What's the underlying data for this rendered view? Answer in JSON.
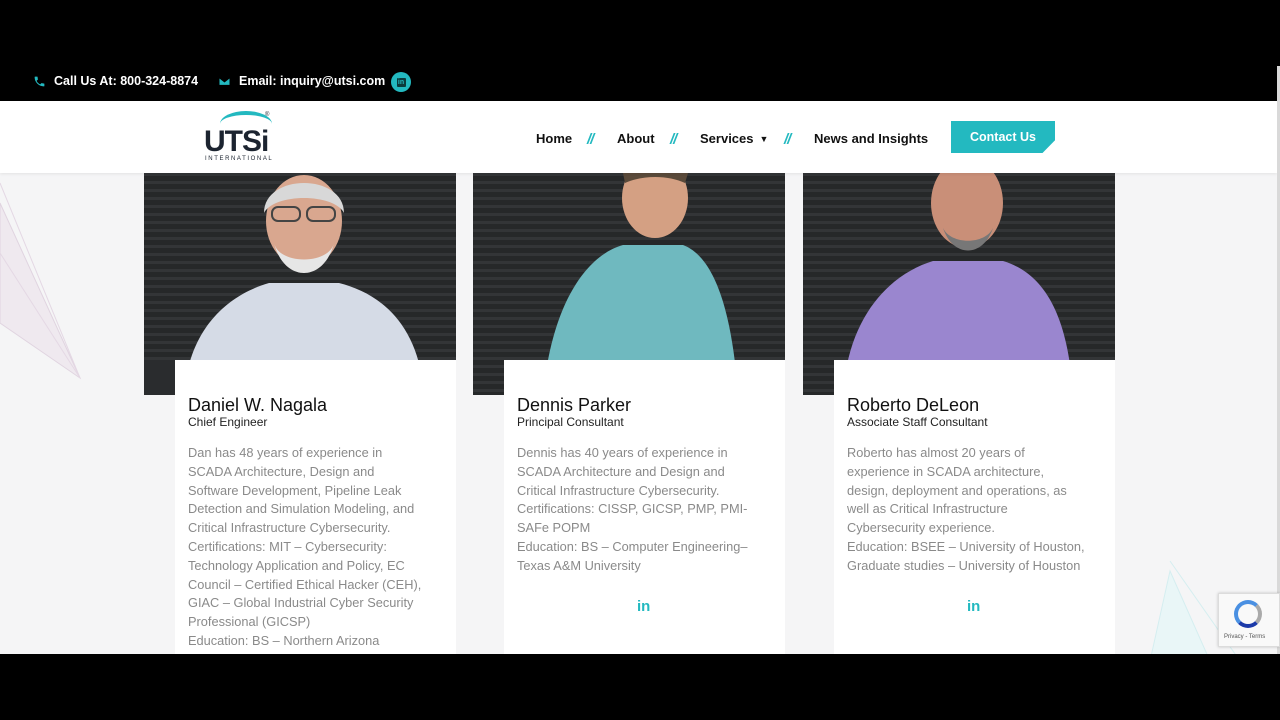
{
  "topbar": {
    "phone": "Call Us At: 800-324-8874",
    "email": "Email: inquiry@utsi.com",
    "linkedin": "in"
  },
  "logo": {
    "name": "UTSi",
    "subtitle": "INTERNATIONAL",
    "reg": "®"
  },
  "nav": {
    "home": "Home",
    "about": "About",
    "services": "Services",
    "news": "News and Insights",
    "separator": "//",
    "contact": "Contact Us"
  },
  "team": [
    {
      "name": "Daniel W. Nagala",
      "role": "Chief Engineer",
      "bio": "Dan has 48 years of experience in\nSCADA Architecture, Design and\nSoftware Development, Pipeline Leak\nDetection and Simulation Modeling, and\nCritical Infrastructure Cybersecurity.\nCertifications: MIT – Cybersecurity:\nTechnology Application and Policy, EC\nCouncil – Certified Ethical Hacker (CEH),\nGIAC – Global Industrial Cyber Security\nProfessional (GICSP)\nEducation: BS – Northern Arizona",
      "linkedin": ""
    },
    {
      "name": "Dennis Parker",
      "role": "Principal Consultant",
      "bio": "Dennis has 40 years of experience in\nSCADA Architecture and Design and\nCritical Infrastructure Cybersecurity.\nCertifications: CISSP, GICSP, PMP, PMI-\nSAFe POPM\nEducation: BS – Computer Engineering–\nTexas A&M University",
      "linkedin": "in"
    },
    {
      "name": "Roberto DeLeon",
      "role": "Associate Staff Consultant",
      "bio": "Roberto has almost 20 years of\nexperience in SCADA architecture,\ndesign, deployment and operations, as\nwell as Critical Infrastructure\nCybersecurity experience.\nEducation: BSEE – University of Houston,\nGraduate studies – University of Houston",
      "linkedin": "in"
    }
  ],
  "recaptcha": {
    "text": "Privacy - Terms"
  },
  "colors": {
    "accent": "#23b9c0",
    "dark": "#000000"
  }
}
